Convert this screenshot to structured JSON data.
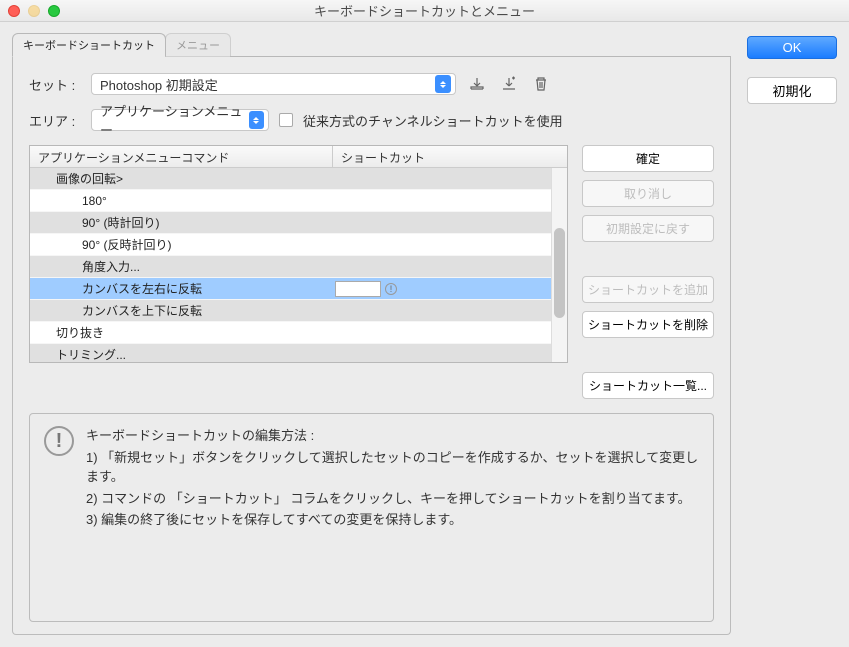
{
  "window": {
    "title": "キーボードショートカットとメニュー"
  },
  "buttons": {
    "ok": "OK",
    "reset": "初期化"
  },
  "tabs": {
    "shortcuts": "キーボードショートカット",
    "menus": "メニュー"
  },
  "set": {
    "label": "セット :",
    "value": "Photoshop 初期設定"
  },
  "area": {
    "label": "エリア :",
    "value": "アプリケーションメニュー"
  },
  "legacy_checkbox": "従来方式のチャンネルショートカットを使用",
  "table": {
    "head_cmd": "アプリケーションメニューコマンド",
    "head_sc": "ショートカット",
    "rows": [
      {
        "label": "画像の回転>",
        "indent": 1,
        "shade": true
      },
      {
        "label": "180°",
        "indent": 2
      },
      {
        "label": "90° (時計回り)",
        "indent": 2,
        "shade": true
      },
      {
        "label": "90° (反時計回り)",
        "indent": 2
      },
      {
        "label": "角度入力...",
        "indent": 2,
        "shade": true
      },
      {
        "label": "カンバスを左右に反転",
        "indent": 2,
        "selected": true,
        "has_input": true
      },
      {
        "label": "カンバスを上下に反転",
        "indent": 2,
        "shade": true
      },
      {
        "label": "切り抜き",
        "indent": 1
      },
      {
        "label": "トリミング...",
        "indent": 1,
        "shade": true
      }
    ]
  },
  "side": {
    "confirm": "確定",
    "undo": "取り消し",
    "default": "初期設定に戻す",
    "add": "ショートカットを追加",
    "del": "ショートカットを削除",
    "list": "ショートカット一覧..."
  },
  "help": {
    "title": "キーボードショートカットの編集方法 :",
    "l1": "1) 「新規セット」ボタンをクリックして選択したセットのコピーを作成するか、セットを選択して変更します。",
    "l2": "2) コマンドの 「ショートカット」 コラムをクリックし、キーを押してショートカットを割り当てます。",
    "l3": "3) 編集の終了後にセットを保存してすべての変更を保持します。"
  }
}
